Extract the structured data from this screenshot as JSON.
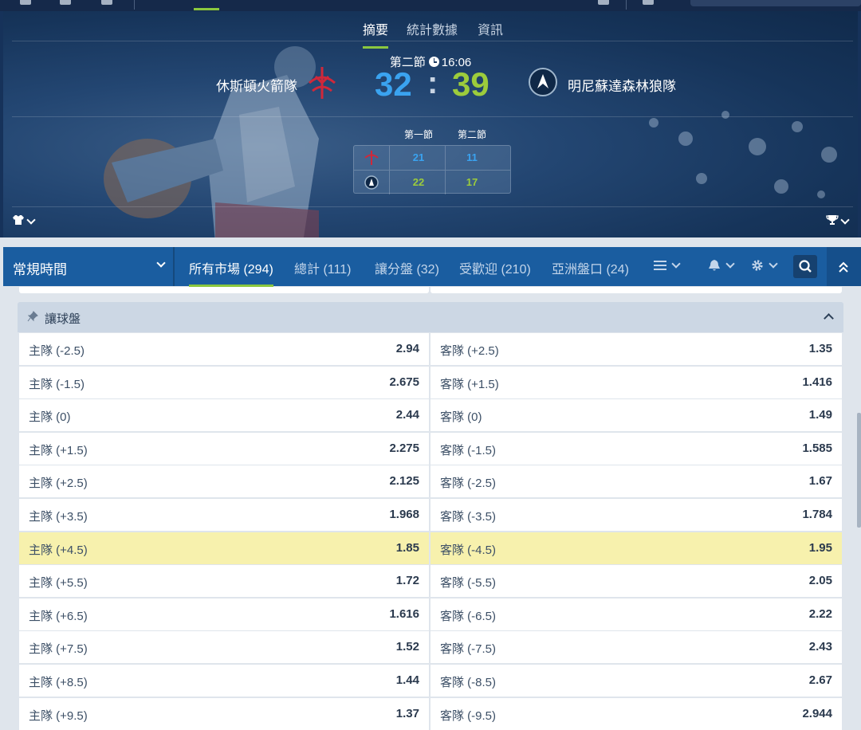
{
  "header_tabs": [
    "摘要",
    "統計數據",
    "資訊"
  ],
  "match": {
    "period": "第二節",
    "clock": "16:06",
    "home": {
      "name": "休斯頓火箭隊",
      "score": "32",
      "logo_icon": "rockets-logo-icon"
    },
    "away": {
      "name": "明尼蘇達森林狼隊",
      "score": "39",
      "logo_icon": "timberwolves-logo-icon"
    },
    "score_separator": ":"
  },
  "quarters": {
    "headers": [
      "第一節",
      "第二節"
    ],
    "home": [
      "21",
      "11"
    ],
    "away": [
      "22",
      "17"
    ]
  },
  "market_nav": {
    "time_select": "常規時間",
    "tabs": [
      "所有市場 (294)",
      "總計 (111)",
      "讓分盤 (32)",
      "受歡迎 (210)",
      "亞洲盤口 (24)"
    ],
    "active_tab": 0
  },
  "market": {
    "title": "讓球盤",
    "rows": [
      {
        "home": "主隊 (-2.5)",
        "home_odd": "2.94",
        "away": "客隊 (+2.5)",
        "away_odd": "1.35"
      },
      {
        "home": "主隊 (-1.5)",
        "home_odd": "2.675",
        "away": "客隊 (+1.5)",
        "away_odd": "1.416"
      },
      {
        "home": "主隊 (0)",
        "home_odd": "2.44",
        "away": "客隊 (0)",
        "away_odd": "1.49"
      },
      {
        "home": "主隊 (+1.5)",
        "home_odd": "2.275",
        "away": "客隊 (-1.5)",
        "away_odd": "1.585"
      },
      {
        "home": "主隊 (+2.5)",
        "home_odd": "2.125",
        "away": "客隊 (-2.5)",
        "away_odd": "1.67"
      },
      {
        "home": "主隊 (+3.5)",
        "home_odd": "1.968",
        "away": "客隊 (-3.5)",
        "away_odd": "1.784"
      },
      {
        "home": "主隊 (+4.5)",
        "home_odd": "1.85",
        "away": "客隊 (-4.5)",
        "away_odd": "1.95",
        "highlight": true
      },
      {
        "home": "主隊 (+5.5)",
        "home_odd": "1.72",
        "away": "客隊 (-5.5)",
        "away_odd": "2.05"
      },
      {
        "home": "主隊 (+6.5)",
        "home_odd": "1.616",
        "away": "客隊 (-6.5)",
        "away_odd": "2.22"
      },
      {
        "home": "主隊 (+7.5)",
        "home_odd": "1.52",
        "away": "客隊 (-7.5)",
        "away_odd": "2.43"
      },
      {
        "home": "主隊 (+8.5)",
        "home_odd": "1.44",
        "away": "客隊 (-8.5)",
        "away_odd": "2.67"
      },
      {
        "home": "主隊 (+9.5)",
        "home_odd": "1.37",
        "away": "客隊 (-9.5)",
        "away_odd": "2.944"
      }
    ]
  },
  "colors": {
    "accent_green": "#8bc83f",
    "home_score": "#3aa3f0",
    "away_score": "#9ccc3c",
    "nav_bg": "#1a5da0",
    "highlight_row": "#f7f1ad"
  }
}
